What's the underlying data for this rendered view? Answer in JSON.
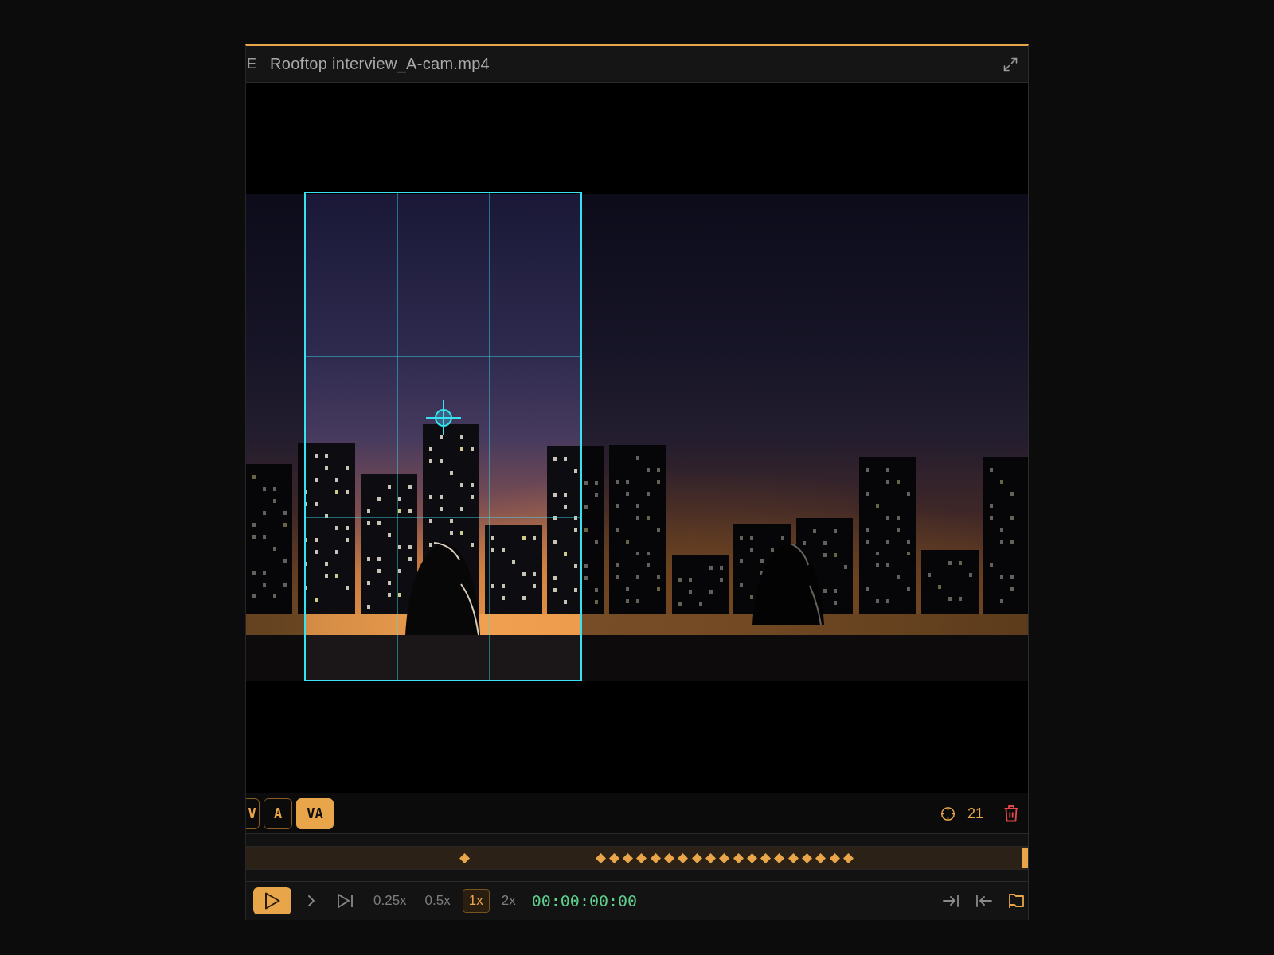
{
  "title_bar": {
    "leading_text": "E",
    "title": "Rooftop interview_A-cam.mp4"
  },
  "track_modes": [
    {
      "label": "V",
      "selected": false
    },
    {
      "label": "A",
      "selected": false
    },
    {
      "label": "VA",
      "selected": true
    }
  ],
  "keyframe_count": "21",
  "speeds": [
    {
      "label": "0.25x",
      "selected": false
    },
    {
      "label": "0.5x",
      "selected": false
    },
    {
      "label": "1x",
      "selected": true
    },
    {
      "label": "2x",
      "selected": false
    }
  ],
  "timecode": "00:00:00:00"
}
